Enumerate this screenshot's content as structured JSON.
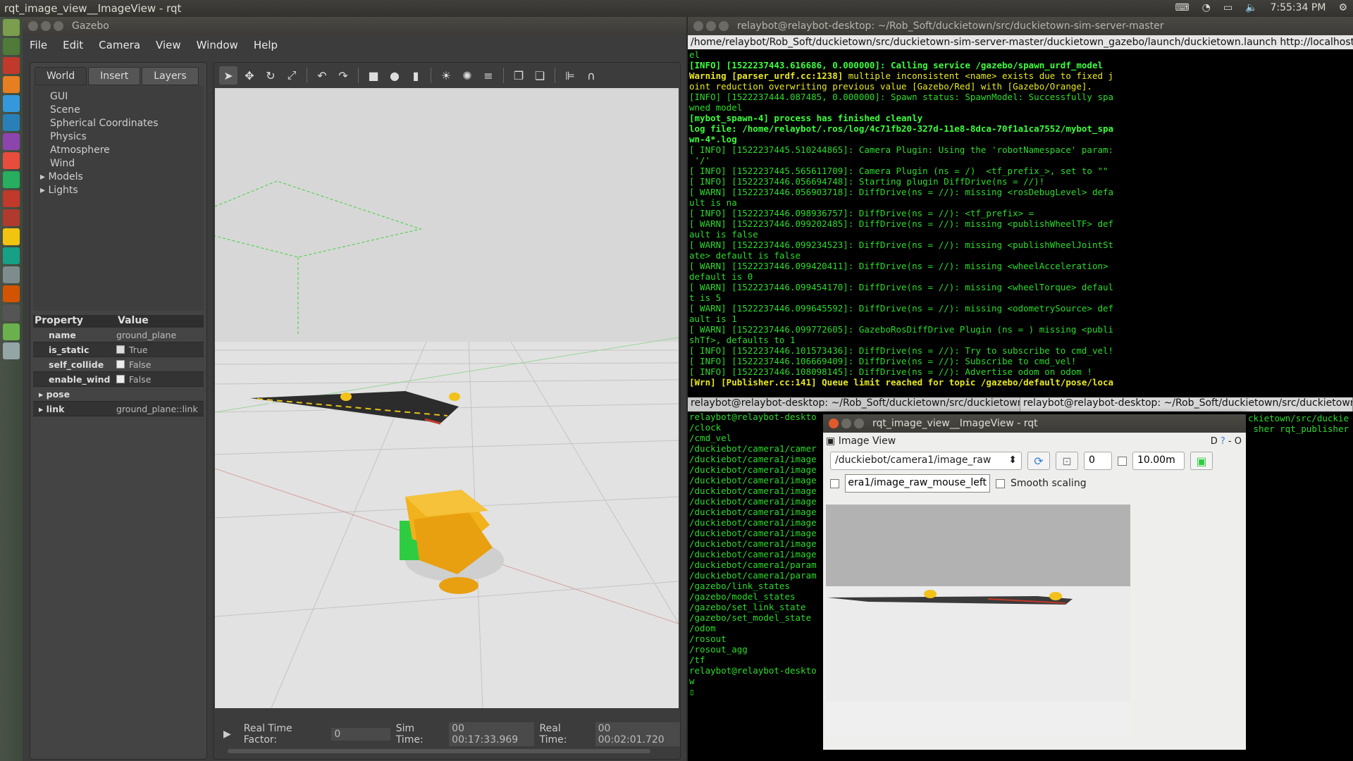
{
  "topbar": {
    "title": "rqt_image_view__ImageView - rqt",
    "time": "7:55:34 PM"
  },
  "gazebo": {
    "window_title": "Gazebo",
    "menu": [
      "File",
      "Edit",
      "Camera",
      "View",
      "Window",
      "Help"
    ],
    "tabs": [
      "World",
      "Insert",
      "Layers"
    ],
    "tree": [
      "GUI",
      "Scene",
      "Spherical Coordinates",
      "Physics",
      "Atmosphere",
      "Wind"
    ],
    "tree_expandable": [
      "Models",
      "Lights"
    ],
    "property_header": {
      "key": "Property",
      "value": "Value"
    },
    "properties": [
      {
        "key": "name",
        "value": "ground_plane"
      },
      {
        "key": "is_static",
        "value": "True"
      },
      {
        "key": "self_collide",
        "value": "False"
      },
      {
        "key": "enable_wind",
        "value": "False"
      }
    ],
    "expandable_props": [
      {
        "key": "pose",
        "value": ""
      },
      {
        "key": "link",
        "value": "ground_plane::link"
      }
    ],
    "status": {
      "rtf_label": "Real Time Factor:",
      "rtf": "0",
      "sim_label": "Sim Time:",
      "sim": "00 00:17:33.969",
      "real_label": "Real Time:",
      "real": "00 00:02:01.720"
    }
  },
  "term1": {
    "title": "relaybot@relaybot-desktop: ~/Rob_Soft/duckietown/src/duckietown-sim-server-master",
    "tab": "/home/relaybot/Rob_Soft/duckietown/src/duckietown-sim-server-master/duckietown_gazebo/launch/duckietown.launch http://localhost:11311"
  },
  "term2": {
    "tab1": "relaybot@relaybot-desktop: ~/Rob_Soft/duckietown/src/duckietown-",
    "tab2": "relaybot@relaybot-desktop: ~/Rob_Soft/duckietown/src/duckietown-",
    "right1": "ckietown/src/duckie",
    "right2": "sher rqt_publisher"
  },
  "rqt": {
    "title": "rqt_image_view__ImageView - rqt",
    "plugin": "Image View",
    "topic": "/duckiebot/camera1/image_raw",
    "spin_value": "0",
    "distance": "10.00m",
    "mouse_topic": "era1/image_raw_mouse_left",
    "smooth_label": "Smooth scaling",
    "corner": "D"
  },
  "colors": {
    "terminal_green": "#2bdc2b",
    "gazebo_bg": "#3c3c3c",
    "robot": "#f2b21b"
  }
}
